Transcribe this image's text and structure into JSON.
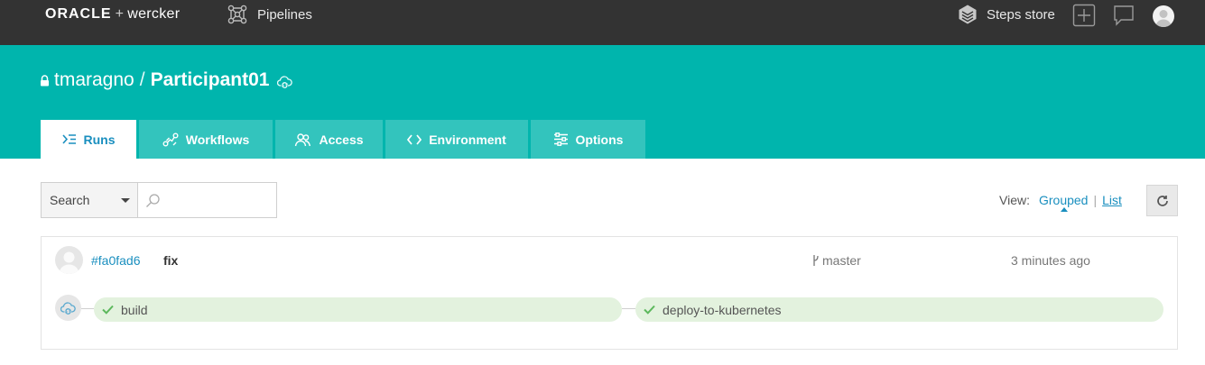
{
  "topbar": {
    "brand_oracle": "ORACLE",
    "brand_plus": "+",
    "brand_wercker": "wercker",
    "pipelines_label": "Pipelines",
    "steps_store_label": "Steps store",
    "icons": [
      "pipelines-icon",
      "steps-store-icon",
      "add-icon",
      "chat-icon",
      "user-avatar"
    ]
  },
  "header": {
    "owner": "tmaragno",
    "separator": "/",
    "repo_name": "Participant01",
    "tabs": [
      {
        "label": "Runs",
        "icon": "runs-icon",
        "active": true
      },
      {
        "label": "Workflows",
        "icon": "workflows-icon",
        "active": false
      },
      {
        "label": "Access",
        "icon": "access-icon",
        "active": false
      },
      {
        "label": "Environment",
        "icon": "code-icon",
        "active": false
      },
      {
        "label": "Options",
        "icon": "options-icon",
        "active": false
      }
    ]
  },
  "search": {
    "select_value": "Search",
    "placeholder": ""
  },
  "view": {
    "label": "View:",
    "grouped": "Grouped",
    "separator": "|",
    "list": "List"
  },
  "run": {
    "commit_hash": "#fa0fad6",
    "message": "fix",
    "branch": "master",
    "time": "3 minutes ago",
    "steps": [
      {
        "label": "build",
        "status": "passed"
      },
      {
        "label": "deploy-to-kubernetes",
        "status": "passed"
      }
    ]
  },
  "colors": {
    "topbar": "#333333",
    "header": "#00b5ad",
    "tab": "#33c4bd",
    "link": "#1a8fbf",
    "step_bg": "#e3f2de",
    "check": "#5cb85c"
  }
}
